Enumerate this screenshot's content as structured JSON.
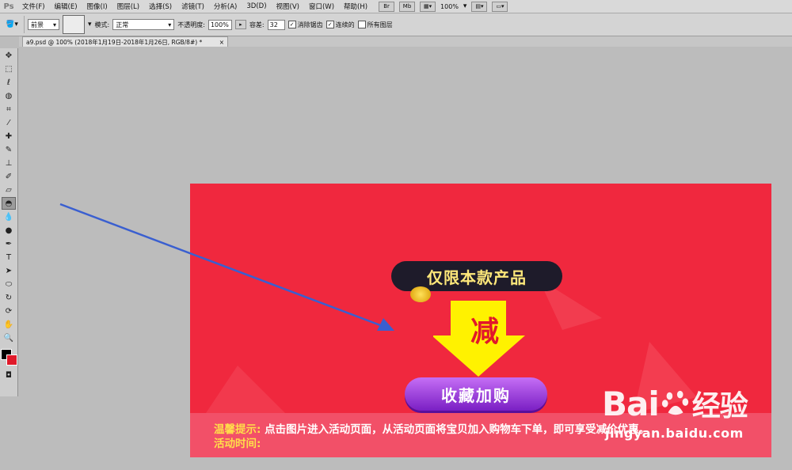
{
  "app": {
    "logo": "Ps"
  },
  "menu": [
    "文件(F)",
    "编辑(E)",
    "图像(I)",
    "图层(L)",
    "选择(S)",
    "滤镜(T)",
    "分析(A)",
    "3D(D)",
    "视图(V)",
    "窗口(W)",
    "帮助(H)"
  ],
  "menubar_right": {
    "br_label": "Br",
    "mb_label": "Mb",
    "zoom": "100%"
  },
  "options": {
    "fill_source": "前景",
    "mode_label": "模式:",
    "mode_value": "正常",
    "opacity_label": "不透明度:",
    "opacity_value": "100%",
    "tolerance_label": "容差:",
    "tolerance_value": "32",
    "antialias_label": "消除锯齿",
    "contiguous_label": "连续的",
    "all_layers_label": "所有图层"
  },
  "document_tab": {
    "title": "a9.psd @ 100% (2018年1月19日-2018年1月26日, RGB/8#) *",
    "close": "×"
  },
  "banner": {
    "pill_text": "仅限本款产品",
    "arrow_text": "减",
    "cta_text": "收藏加购",
    "tip1_label": "温馨提示:",
    "tip1_text": "点击图片进入活动页面，从活动页面将宝贝加入购物车下单，即可享受减价优惠。",
    "tip2_label": "活动时间:"
  },
  "watermark": {
    "brand_a": "Bai",
    "brand_b": "经验",
    "url": "jingyan.baidu.com"
  },
  "colors": {
    "banner_red": "#f0283e",
    "pill_bg": "#1e1b2a",
    "pill_text": "#ffe87a",
    "arrow_yellow": "#fff200",
    "cta_purple": "#8a2be2",
    "tip_label": "#ffde4a",
    "annotation_blue": "#3a5fd0"
  },
  "icons": [
    "move-icon",
    "marquee-icon",
    "lasso-icon",
    "quick-select-icon",
    "crop-icon",
    "eyedropper-icon",
    "healing-icon",
    "brush-icon",
    "stamp-icon",
    "history-brush-icon",
    "eraser-icon",
    "paint-bucket-icon",
    "blur-icon",
    "dodge-icon",
    "pen-icon",
    "type-icon",
    "path-select-icon",
    "shape-icon",
    "3d-rotate-icon",
    "3d-orbit-icon",
    "hand-icon",
    "zoom-icon"
  ]
}
